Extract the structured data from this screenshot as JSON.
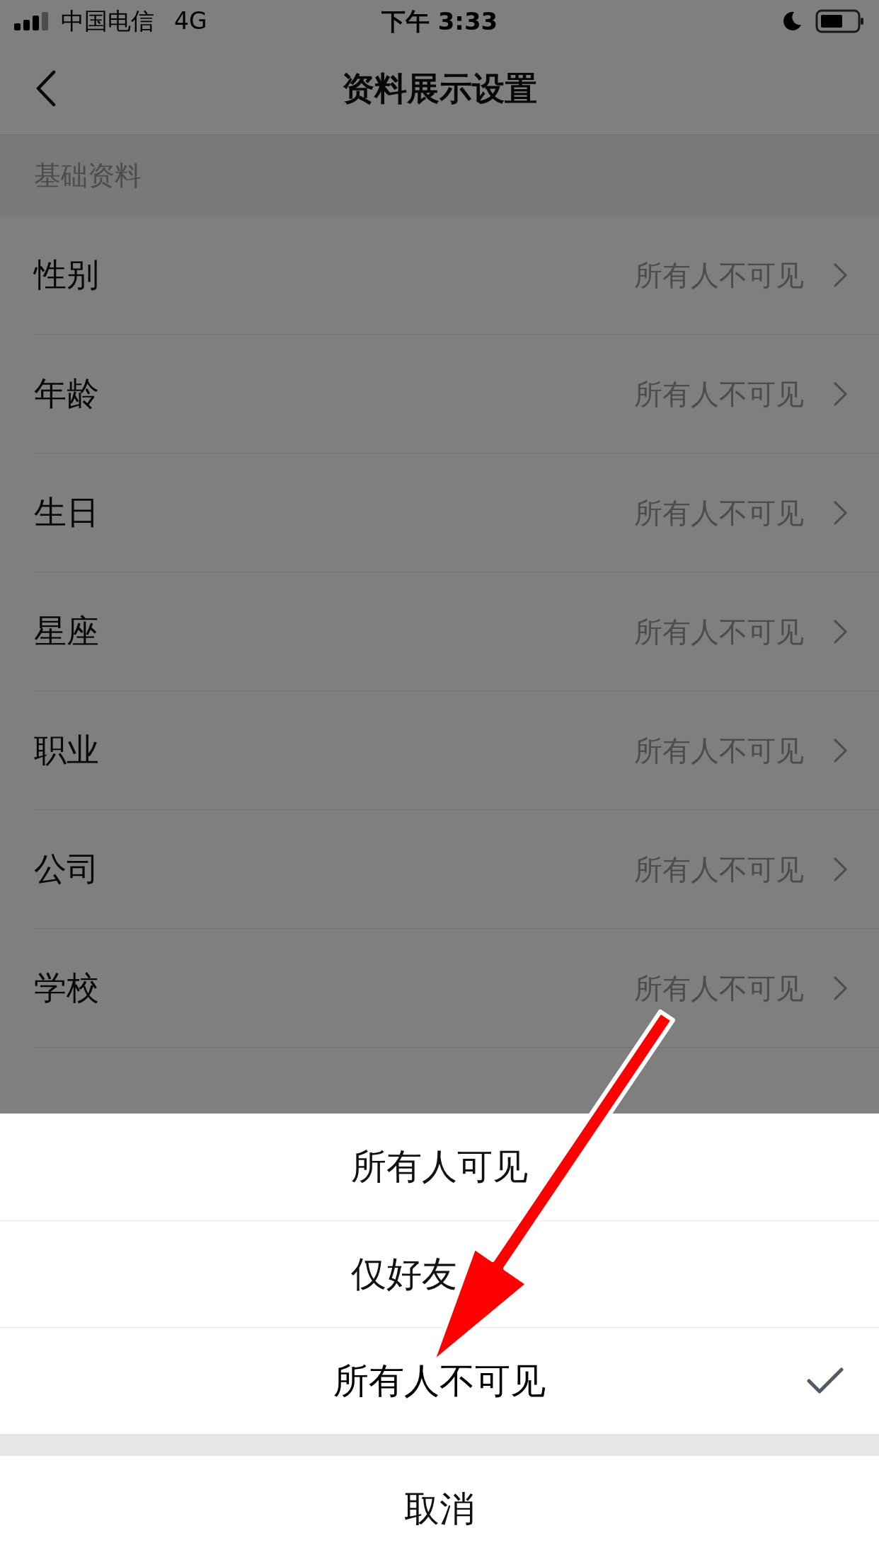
{
  "status_bar": {
    "carrier": "中国电信",
    "network": "4G",
    "time": "下午 3:33"
  },
  "nav": {
    "title": "资料展示设置"
  },
  "section": {
    "title": "基础资料"
  },
  "rows": [
    {
      "label": "性别",
      "value": "所有人不可见"
    },
    {
      "label": "年龄",
      "value": "所有人不可见"
    },
    {
      "label": "生日",
      "value": "所有人不可见"
    },
    {
      "label": "星座",
      "value": "所有人不可见"
    },
    {
      "label": "职业",
      "value": "所有人不可见"
    },
    {
      "label": "公司",
      "value": "所有人不可见"
    },
    {
      "label": "学校",
      "value": "所有人不可见"
    }
  ],
  "action_sheet": {
    "options": [
      {
        "label": "所有人可见",
        "selected": false
      },
      {
        "label": "仅好友",
        "selected": false
      },
      {
        "label": "所有人不可见",
        "selected": true
      }
    ],
    "cancel": "取消"
  }
}
